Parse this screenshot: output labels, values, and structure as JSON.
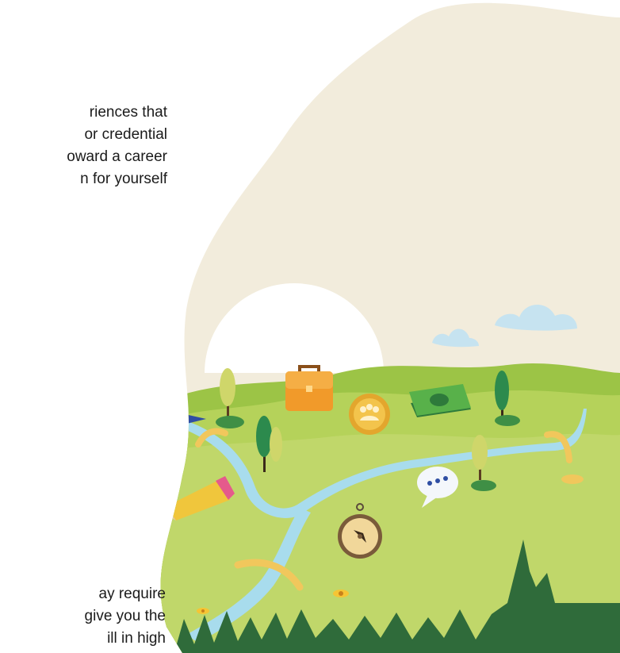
{
  "paragraphs": {
    "top_lines": [
      "riences that",
      "or credential",
      "oward a career",
      "n for yourself"
    ],
    "bottom_lines": [
      "ay require",
      "give you the",
      "ill in high"
    ]
  },
  "colors": {
    "blob": "#f2ecdc",
    "hills_back": "#9cc446",
    "hills_mid": "#b5d25a",
    "meadow": "#c0d76a",
    "river": "#a8dced",
    "arrow": "#f1c75c",
    "grass": "#2f6b3a"
  },
  "icons": [
    "pennant-flag-icon",
    "pencil-icon",
    "briefcase-icon",
    "community-coin-icon",
    "money-stack-icon",
    "chat-bubble-icon",
    "compass-icon",
    "cloud-icon",
    "tree-icon",
    "flower-icon"
  ]
}
